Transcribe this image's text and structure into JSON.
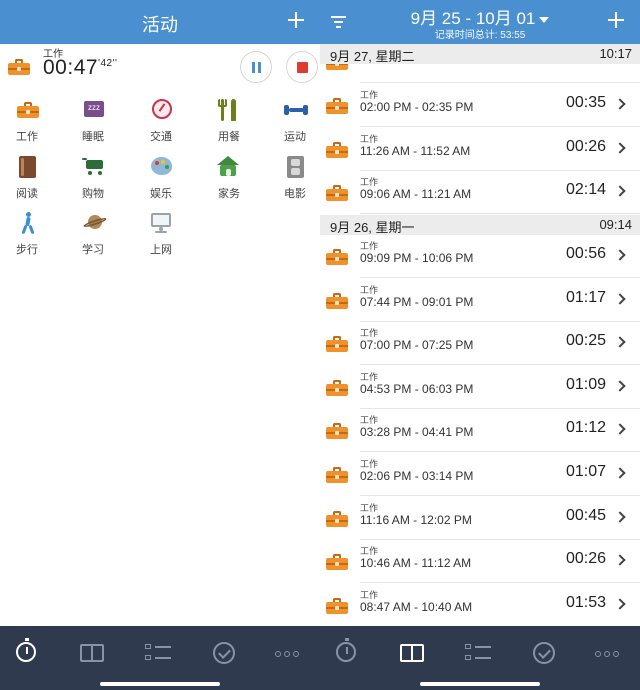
{
  "left_pane": {
    "header": {
      "title": "活动"
    },
    "current": {
      "activity_label": "工作",
      "elapsed": "00:47",
      "elapsed_seconds": "'42''"
    },
    "categories": [
      {
        "label": "工作",
        "icon": "toolbox-icon"
      },
      {
        "label": "睡眠",
        "icon": "sleep-icon"
      },
      {
        "label": "交通",
        "icon": "compass-icon"
      },
      {
        "label": "用餐",
        "icon": "fork-knife-icon"
      },
      {
        "label": "运动",
        "icon": "dumbbell-icon"
      },
      {
        "label": "阅读",
        "icon": "book-icon"
      },
      {
        "label": "购物",
        "icon": "cart-icon"
      },
      {
        "label": "娱乐",
        "icon": "palette-icon"
      },
      {
        "label": "家务",
        "icon": "house-icon"
      },
      {
        "label": "电影",
        "icon": "film-icon"
      },
      {
        "label": "步行",
        "icon": "walker-icon"
      },
      {
        "label": "学习",
        "icon": "planet-icon"
      },
      {
        "label": "上网",
        "icon": "monitor-icon"
      }
    ]
  },
  "right_pane": {
    "header": {
      "date_range": "9月 25 - 10月 01",
      "total": "记录时间总计: 53:55"
    },
    "sections": [
      {
        "day": "9月 27, 星期二",
        "duration": "10:17",
        "rows": [
          {
            "label": "工作",
            "range": "02:00 PM - 02:35 PM",
            "duration": "00:35"
          },
          {
            "label": "工作",
            "range": "11:26 AM - 11:52 AM",
            "duration": "00:26"
          },
          {
            "label": "工作",
            "range": "09:06 AM - 11:21 AM",
            "duration": "02:14"
          }
        ]
      },
      {
        "day": "9月 26, 星期一",
        "duration": "09:14",
        "rows": [
          {
            "label": "工作",
            "range": "09:09 PM - 10:06 PM",
            "duration": "00:56"
          },
          {
            "label": "工作",
            "range": "07:44 PM - 09:01 PM",
            "duration": "01:17"
          },
          {
            "label": "工作",
            "range": "07:00 PM - 07:25 PM",
            "duration": "00:25"
          },
          {
            "label": "工作",
            "range": "04:53 PM - 06:03 PM",
            "duration": "01:09"
          },
          {
            "label": "工作",
            "range": "03:28 PM - 04:41 PM",
            "duration": "01:12"
          },
          {
            "label": "工作",
            "range": "02:06 PM - 03:14 PM",
            "duration": "01:07"
          },
          {
            "label": "工作",
            "range": "11:16 AM - 12:02 PM",
            "duration": "00:45"
          },
          {
            "label": "工作",
            "range": "10:46 AM - 11:12 AM",
            "duration": "00:26"
          },
          {
            "label": "工作",
            "range": "08:47 AM - 10:40 AM",
            "duration": "01:53"
          }
        ]
      }
    ]
  },
  "tabbar": {
    "tabs": [
      "stopwatch-icon",
      "book-icon",
      "list-icon",
      "check-icon",
      "more-icon"
    ],
    "active_color": "#ffffff",
    "inactive_color": "#8a93a5"
  },
  "colors": {
    "header": "#4a90d0",
    "work": "#f0922b",
    "tabbar": "#2f3a4e",
    "stop": "#e03a2f"
  }
}
